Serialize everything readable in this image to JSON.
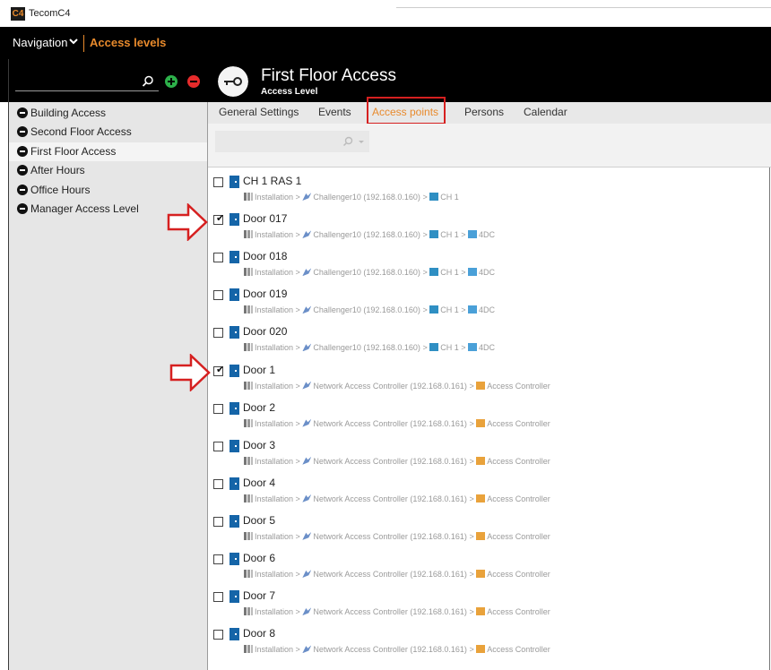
{
  "window": {
    "logo_text": "C4",
    "title": "TecomC4"
  },
  "nav": {
    "label": "Navigation",
    "active": "Access levels"
  },
  "header": {
    "title": "First Floor Access",
    "subtitle": "Access Level"
  },
  "sidebar": {
    "items": [
      {
        "label": "Building Access",
        "selected": false
      },
      {
        "label": "Second Floor Access",
        "selected": false
      },
      {
        "label": "First Floor Access",
        "selected": true
      },
      {
        "label": "After Hours",
        "selected": false
      },
      {
        "label": "Office Hours",
        "selected": false
      },
      {
        "label": "Manager Access Level",
        "selected": false
      }
    ]
  },
  "tabs": [
    {
      "label": "General Settings",
      "active": false
    },
    {
      "label": "Events",
      "active": false
    },
    {
      "label": "Access points",
      "active": true
    },
    {
      "label": "Persons",
      "active": false
    },
    {
      "label": "Calendar",
      "active": false
    }
  ],
  "access_points": [
    {
      "name": "CH 1 RAS 1",
      "checked": false,
      "path": [
        "Installation",
        "Challenger10 (192.168.0.160)",
        "CH 1"
      ]
    },
    {
      "name": "Door 017",
      "checked": true,
      "path": [
        "Installation",
        "Challenger10 (192.168.0.160)",
        "CH 1",
        "4DC"
      ]
    },
    {
      "name": "Door 018",
      "checked": false,
      "path": [
        "Installation",
        "Challenger10 (192.168.0.160)",
        "CH 1",
        "4DC"
      ]
    },
    {
      "name": "Door 019",
      "checked": false,
      "path": [
        "Installation",
        "Challenger10 (192.168.0.160)",
        "CH 1",
        "4DC"
      ]
    },
    {
      "name": "Door 020",
      "checked": false,
      "path": [
        "Installation",
        "Challenger10 (192.168.0.160)",
        "CH 1",
        "4DC"
      ]
    },
    {
      "name": "Door 1",
      "checked": true,
      "path": [
        "Installation",
        "Network Access Controller (192.168.0.161)",
        "Access Controller"
      ]
    },
    {
      "name": "Door 2",
      "checked": false,
      "path": [
        "Installation",
        "Network Access Controller (192.168.0.161)",
        "Access Controller"
      ]
    },
    {
      "name": "Door 3",
      "checked": false,
      "path": [
        "Installation",
        "Network Access Controller (192.168.0.161)",
        "Access Controller"
      ]
    },
    {
      "name": "Door 4",
      "checked": false,
      "path": [
        "Installation",
        "Network Access Controller (192.168.0.161)",
        "Access Controller"
      ]
    },
    {
      "name": "Door 5",
      "checked": false,
      "path": [
        "Installation",
        "Network Access Controller (192.168.0.161)",
        "Access Controller"
      ]
    },
    {
      "name": "Door 6",
      "checked": false,
      "path": [
        "Installation",
        "Network Access Controller (192.168.0.161)",
        "Access Controller"
      ]
    },
    {
      "name": "Door 7",
      "checked": false,
      "path": [
        "Installation",
        "Network Access Controller (192.168.0.161)",
        "Access Controller"
      ]
    },
    {
      "name": "Door 8",
      "checked": false,
      "path": [
        "Installation",
        "Network Access Controller (192.168.0.161)",
        "Access Controller"
      ]
    }
  ],
  "path_separator": ">",
  "colors": {
    "accent": "#e88a2c",
    "annotation_red": "#d62020",
    "add_green": "#2db04a",
    "remove_red": "#e62b2b",
    "door_blue": "#1565a8"
  },
  "icons": {
    "sidebar_item": "access-level-icon",
    "access_point": "door-icon"
  }
}
